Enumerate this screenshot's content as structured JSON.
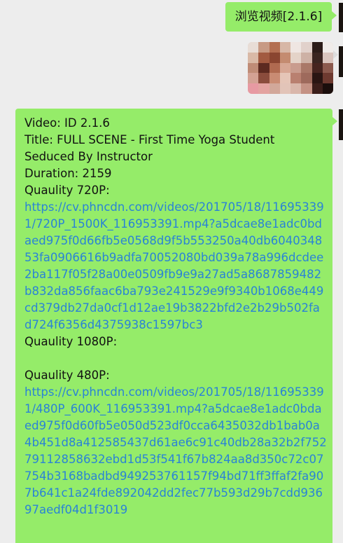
{
  "chat": {
    "msg1": "浏览视频[2.1.6]",
    "msg3": {
      "video_id": "Video: ID 2.1.6",
      "title_l1": "Title: FULL SCENE - First Time Yoga Student",
      "title_l2": "Seduced By Instructor",
      "duration": "Duration: 2159",
      "q720_label": "Quaulity 720P:",
      "q720_link": "https://cv.phncdn.com/videos/201705/18/116953391/720P_1500K_116953391.mp4?a5dcae8e1adc0bdaed975f0d66fb5e0568d9f5b553250a40db604034853fa0906616b9adfa70052080bd039a78a996dcdee2ba117f05f28a00e0509fb9e9a27ad5a8687859482b832da856faac6ba793e241529e9f9340b1068e449cd379db27da0cf1d12ae19b3822bfd2e2b29b502fad724f6356d4375938c1597bc3",
      "q1080_label": "Quaulity 1080P:",
      "q480_label": "Quaulity 480P:",
      "q480_link": "https://cv.phncdn.com/videos/201705/18/116953391/480P_600K_116953391.mp4?a5dcae8e1adc0bdaed975f0d60fb5e050d523df0cca6435032db1bab0a4b451d8a412585437d61ae6c91c40db28a32b2f75279112858632ebd1d53f541f67b824aa8d350c72c07754b3168badbd949253761157f94bd71ff3ffaf2fa907b641c1a24fde892042dd2fec77b593d29b7cdd93697aedf04d1f3019"
    }
  },
  "colors": {
    "background": "#ededed",
    "bubble": "#95ec69",
    "link": "#2a83d6"
  }
}
